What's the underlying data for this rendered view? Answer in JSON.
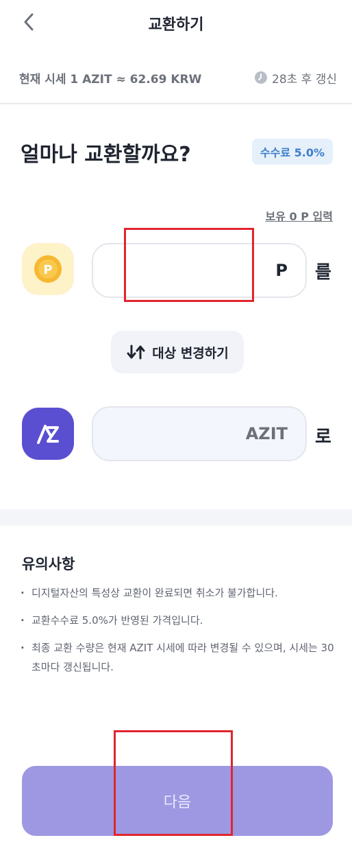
{
  "header": {
    "title": "교환하기",
    "back_icon": "chevron-left-icon"
  },
  "rate": {
    "text": "현재 시세 1 AZIT ≈ 62.69 KRW",
    "refresh_text": "28초 후 갱신",
    "refresh_icon": "clock-icon"
  },
  "main": {
    "question": "얼마나 교환할까요?",
    "fee_badge": "수수료 5.0%",
    "holding_link": "보유 0 P 입력",
    "from": {
      "icon": "point-coin-icon",
      "value": "",
      "unit": "P",
      "suffix": "를"
    },
    "swap_button": {
      "label": "대상 변경하기",
      "icon": "swap-arrows-icon"
    },
    "to": {
      "icon": "azit-logo-icon",
      "unit": "AZIT",
      "suffix": "로"
    }
  },
  "notice": {
    "title": "유의사항",
    "items": [
      "디지털자산의 특성상 교환이 완료되면 취소가 불가합니다.",
      "교환수수료 5.0%가 반영된 가격입니다.",
      "최종 교환 수량은 현재 AZIT 시세에 따라 변경될 수 있으며, 시세는 30초마다 갱신됩니다."
    ]
  },
  "footer": {
    "next_label": "다음"
  },
  "colors": {
    "accent": "#5a4fd1",
    "next_button": "#9d98e1",
    "fee_badge_bg": "#e6f0fb",
    "fee_badge_text": "#3d7fcb",
    "highlight": "#e1252c"
  }
}
